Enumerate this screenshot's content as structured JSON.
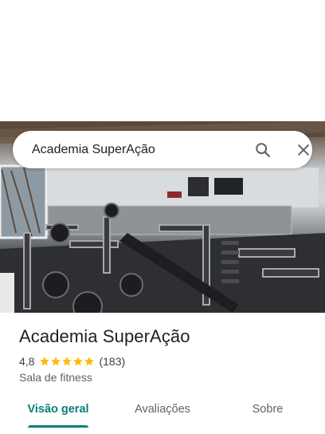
{
  "search": {
    "query": "Academia SuperAção"
  },
  "place": {
    "name": "Academia SuperAção",
    "rating": "4,8",
    "stars": 4.8,
    "reviews_count": "(183)",
    "category": "Sala de fitness"
  },
  "tabs": [
    {
      "label": "Visão geral",
      "active": true
    },
    {
      "label": "Avaliações",
      "active": false
    },
    {
      "label": "Sobre",
      "active": false
    }
  ],
  "colors": {
    "accent": "#0b7e78",
    "star": "#fbbc04"
  },
  "icons": {
    "search": "search-icon",
    "close": "close-icon"
  }
}
